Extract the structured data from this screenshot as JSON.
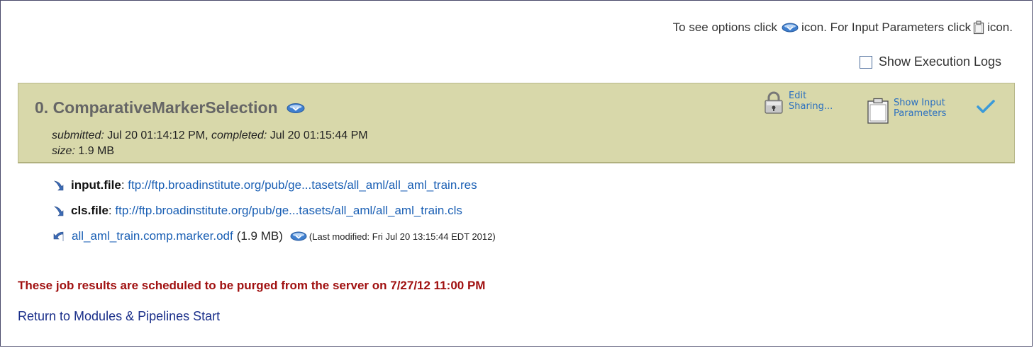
{
  "header": {
    "help_prefix": "To see options click",
    "help_middle": "icon. For Input Parameters click",
    "help_suffix": "icon.",
    "show_logs_label": "Show Execution Logs",
    "show_logs_checked": false
  },
  "job": {
    "title": "0. ComparativeMarkerSelection",
    "submitted_label": "submitted:",
    "submitted_value": "Jul 20 01:14:12 PM,",
    "completed_label": "completed:",
    "completed_value": "Jul 20 01:15:44 PM",
    "size_label": "size:",
    "size_value": "1.9 MB",
    "edit_line1": "Edit",
    "edit_line2": "Sharing...",
    "params_line1": "Show Input",
    "params_line2": "Parameters",
    "panel_color": "#d8d8aa",
    "check_color": "#3a9ad9"
  },
  "files": {
    "inputs": [
      {
        "name": "input.file",
        "sep": ":",
        "url": "ftp://ftp.broadinstitute.org/pub/ge...tasets/all_aml/all_aml_train.res"
      },
      {
        "name": "cls.file",
        "sep": ":",
        "url": "ftp://ftp.broadinstitute.org/pub/ge...tasets/all_aml/all_aml_train.cls"
      }
    ],
    "output": {
      "name": "all_aml_train.comp.marker.odf",
      "size": "(1.9 MB)",
      "modified": "(Last modified: Fri Jul 20 13:15:44 EDT 2012)"
    }
  },
  "footer": {
    "purge_notice": "These job results are scheduled to be purged from the server on 7/27/12 11:00 PM",
    "return_link": "Return to Modules & Pipelines Start",
    "purge_color": "#a01010"
  }
}
